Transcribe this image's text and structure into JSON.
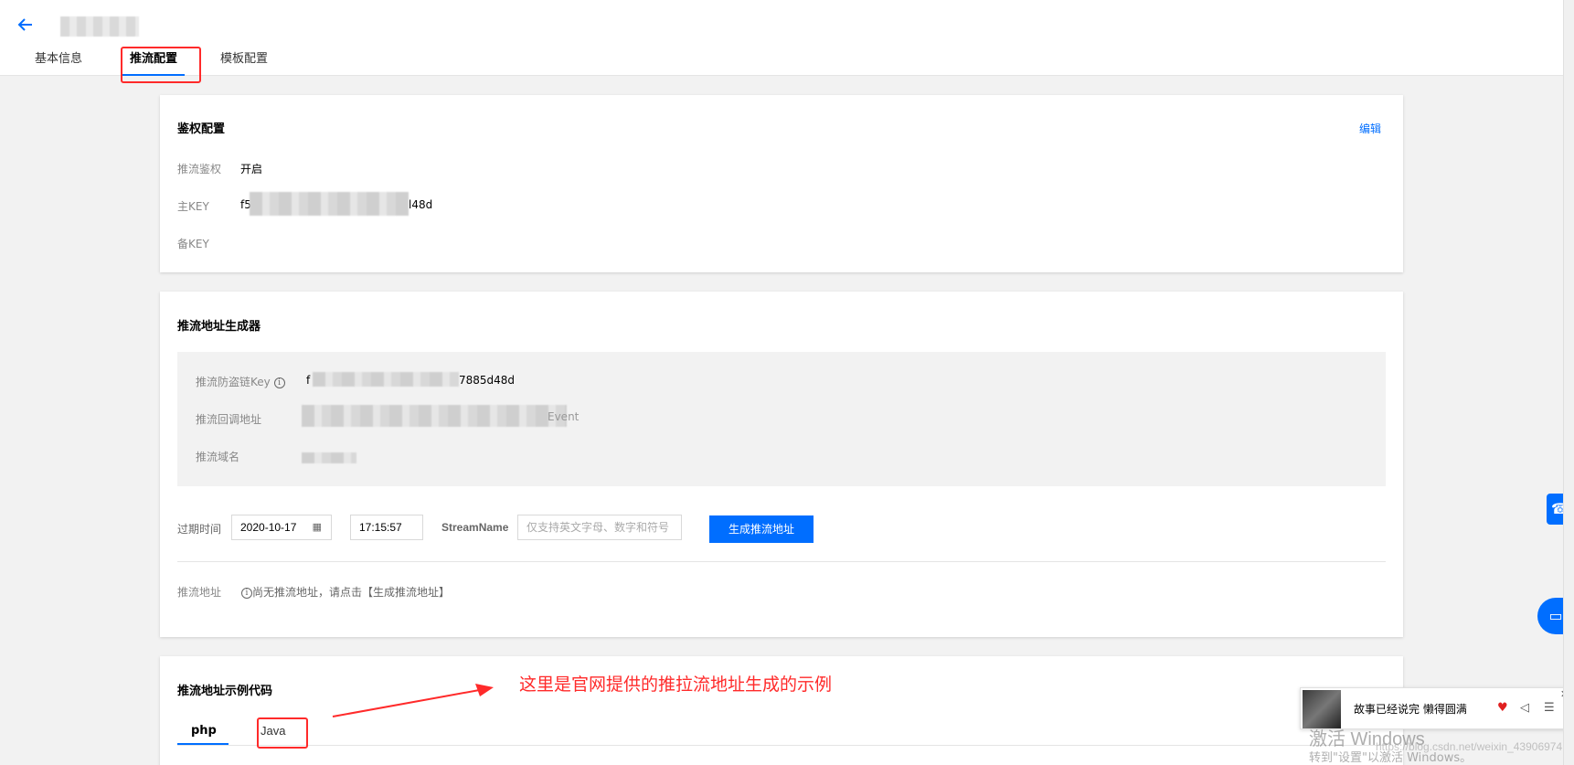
{
  "header": {
    "back_icon": "arrow-left-icon"
  },
  "tabs": [
    {
      "label": "基本信息"
    },
    {
      "label": "推流配置"
    },
    {
      "label": "模板配置"
    }
  ],
  "auth": {
    "title": "鉴权配置",
    "edit_label": "编辑",
    "rows": [
      {
        "label": "推流鉴权",
        "value": "开启"
      },
      {
        "label": "主KEY",
        "value_start": "f5",
        "value_end": "l48d"
      },
      {
        "label": "备KEY",
        "value": ""
      }
    ]
  },
  "generator": {
    "title": "推流地址生成器",
    "key_label": "推流防盗链Key",
    "key_value_start": "f",
    "key_value_end": "7885d48d",
    "callback_label": "推流回调地址",
    "callback_value_end": "Event",
    "domain_label": "推流域名",
    "expire_label": "过期时间",
    "date_value": "2020-10-17",
    "time_value": "17:15:57",
    "stream_label": "StreamName",
    "stream_placeholder": "仅支持英文字母、数字和符号",
    "generate_button": "生成推流地址",
    "address_label": "推流地址",
    "address_hint": "尚无推流地址，请点击【生成推流地址】"
  },
  "example": {
    "title": "推流地址示例代码",
    "tabs": [
      "php",
      "Java"
    ]
  },
  "annotation": "这里是官网提供的推拉流地址生成的示例",
  "music": {
    "song": "故事已经说完  懒得圆满"
  },
  "watermark": {
    "line1": "激活 Windows",
    "line2": "转到\"设置\"以激活 Windows。",
    "csdn": "https://blog.csdn.net/weixin_43906974"
  },
  "colors": {
    "accent": "#006eff",
    "annotation": "#ff2a2a"
  }
}
